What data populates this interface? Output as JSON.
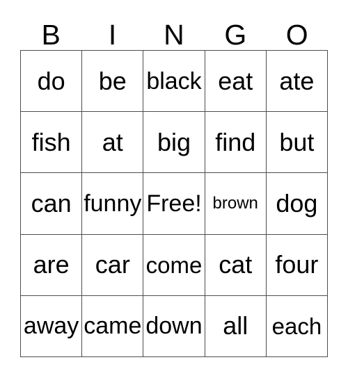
{
  "card": {
    "title": "BINGO",
    "header": {
      "letters": [
        "B",
        "I",
        "N",
        "G",
        "O"
      ]
    },
    "free_space": "Free!",
    "colors": {
      "background": "#ffffff",
      "text": "#000000",
      "grid_line": "#4d4d4d"
    },
    "grid": {
      "columns": 5,
      "rows": 5,
      "cells": [
        [
          {
            "text": "do",
            "size": "normal"
          },
          {
            "text": "be",
            "size": "normal"
          },
          {
            "text": "black",
            "size": "wide"
          },
          {
            "text": "eat",
            "size": "normal"
          },
          {
            "text": "ate",
            "size": "normal"
          }
        ],
        [
          {
            "text": "fish",
            "size": "normal"
          },
          {
            "text": "at",
            "size": "normal"
          },
          {
            "text": "big",
            "size": "normal"
          },
          {
            "text": "find",
            "size": "normal"
          },
          {
            "text": "but",
            "size": "normal"
          }
        ],
        [
          {
            "text": "can",
            "size": "normal"
          },
          {
            "text": "funny",
            "size": "wide"
          },
          {
            "text": "Free!",
            "size": "wide"
          },
          {
            "text": "brown",
            "size": "small"
          },
          {
            "text": "dog",
            "size": "normal"
          }
        ],
        [
          {
            "text": "are",
            "size": "normal"
          },
          {
            "text": "car",
            "size": "normal"
          },
          {
            "text": "come",
            "size": "medium"
          },
          {
            "text": "cat",
            "size": "normal"
          },
          {
            "text": "four",
            "size": "normal"
          }
        ],
        [
          {
            "text": "away",
            "size": "wide"
          },
          {
            "text": "came",
            "size": "wide"
          },
          {
            "text": "down",
            "size": "wide"
          },
          {
            "text": "all",
            "size": "normal"
          },
          {
            "text": "each",
            "size": "medium"
          }
        ]
      ]
    }
  }
}
